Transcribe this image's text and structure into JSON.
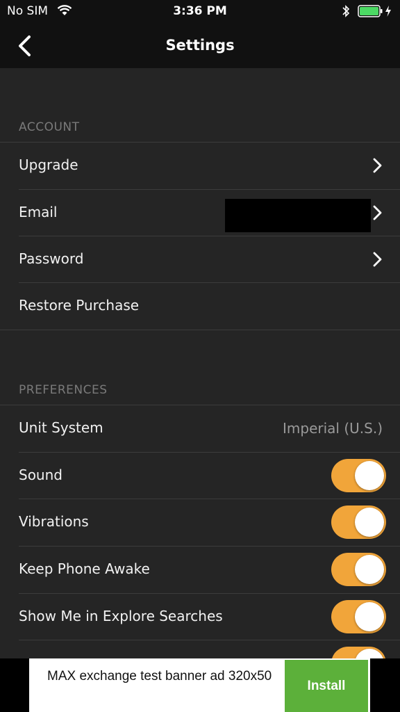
{
  "status_bar": {
    "carrier": "No SIM",
    "time": "3:36 PM",
    "battery_color": "#4cd964"
  },
  "nav": {
    "title": "Settings"
  },
  "account": {
    "header": "ACCOUNT",
    "rows": [
      {
        "label": "Upgrade"
      },
      {
        "label": "Email"
      },
      {
        "label": "Password"
      },
      {
        "label": "Restore Purchase"
      }
    ]
  },
  "preferences": {
    "header": "PREFERENCES",
    "unit_system": {
      "label": "Unit System",
      "value": "Imperial (U.S.)"
    },
    "toggles": [
      {
        "label": "Sound",
        "on": true
      },
      {
        "label": "Vibrations",
        "on": true
      },
      {
        "label": "Keep Phone Awake",
        "on": true
      },
      {
        "label": "Show Me in Explore Searches",
        "on": true
      }
    ]
  },
  "ad": {
    "text": "MAX exchange test banner ad 320x50",
    "button_label": "Install"
  },
  "colors": {
    "toggle_on": "#f1a53a",
    "background": "#252525",
    "bar": "#111111",
    "install": "#5cb03a"
  }
}
